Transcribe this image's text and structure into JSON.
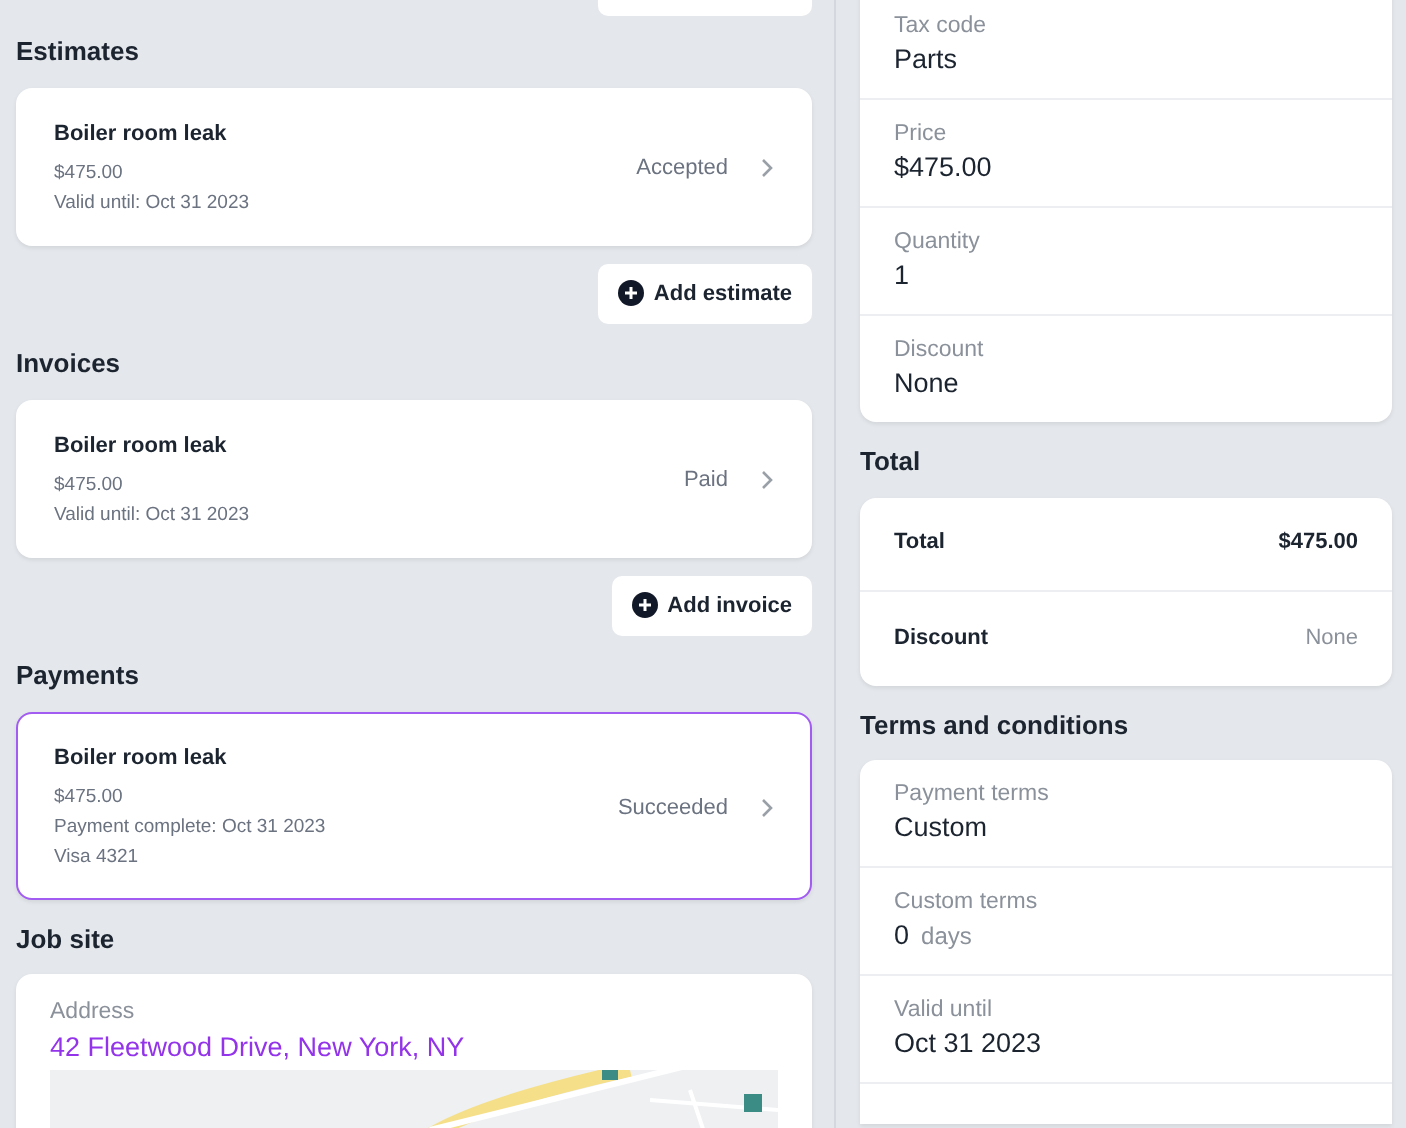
{
  "sections": [
    {
      "title": "Estimates",
      "items": [
        {
          "title": "Boiler room leak",
          "amount": "$475.00",
          "details": [
            "Valid until: Oct 31 2023"
          ],
          "status": "Accepted",
          "selected": false
        }
      ],
      "add_button": "Add estimate"
    },
    {
      "title": "Invoices",
      "items": [
        {
          "title": "Boiler room leak",
          "amount": "$475.00",
          "details": [
            "Valid until: Oct 31 2023"
          ],
          "status": "Paid",
          "selected": false
        }
      ],
      "add_button": "Add invoice"
    },
    {
      "title": "Payments",
      "items": [
        {
          "title": "Boiler room leak",
          "amount": "$475.00",
          "details": [
            "Payment complete: Oct 31 2023",
            "Visa 4321"
          ],
          "status": "Succeeded",
          "selected": true
        }
      ]
    }
  ],
  "job_site": {
    "title": "Job site",
    "address_label": "Address",
    "address": "42 Fleetwood Drive, New York, NY"
  },
  "line_item": {
    "fields": [
      {
        "label": "Tax code",
        "value": "Parts"
      },
      {
        "label": "Price",
        "value": "$475.00"
      },
      {
        "label": "Quantity",
        "value": "1"
      },
      {
        "label": "Discount",
        "value": "None"
      }
    ]
  },
  "total": {
    "title": "Total",
    "rows": [
      {
        "label": "Total",
        "value": "$475.00",
        "kind": "strong"
      },
      {
        "label": "Discount",
        "value": "None",
        "kind": "muted"
      }
    ]
  },
  "terms": {
    "title": "Terms and conditions",
    "fields": [
      {
        "label": "Payment terms",
        "value": "Custom"
      },
      {
        "label": "Custom terms",
        "value": "0",
        "unit": "days"
      },
      {
        "label": "Valid until",
        "value": "Oct 31 2023"
      }
    ]
  }
}
